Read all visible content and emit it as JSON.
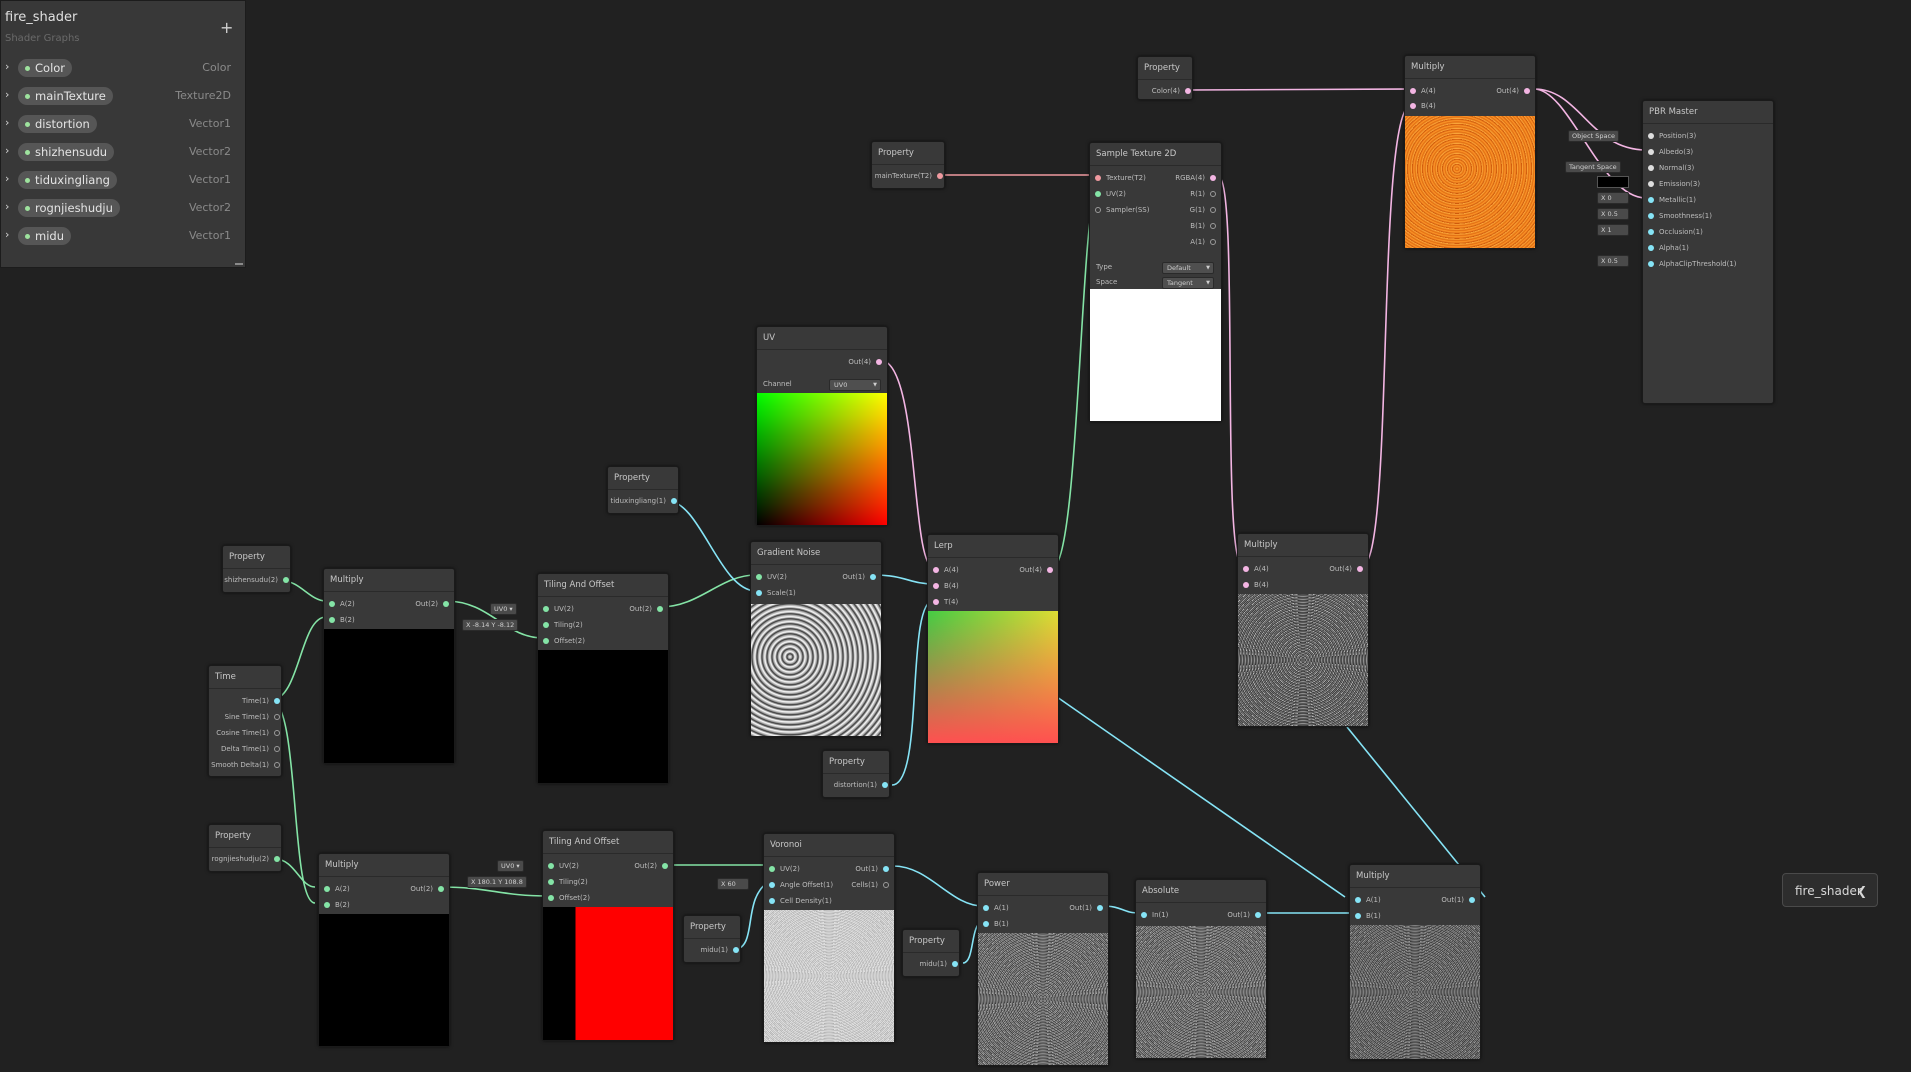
{
  "blackboard": {
    "title": "fire_shader",
    "subtitle": "Shader Graphs",
    "add_label": "+",
    "properties": [
      {
        "name": "Color",
        "type": "Color"
      },
      {
        "name": "mainTexture",
        "type": "Texture2D"
      },
      {
        "name": "distortion",
        "type": "Vector1"
      },
      {
        "name": "shizhensudu",
        "type": "Vector2"
      },
      {
        "name": "tiduxingliang",
        "type": "Vector1"
      },
      {
        "name": "rognjieshudju",
        "type": "Vector2"
      },
      {
        "name": "midu",
        "type": "Vector1"
      }
    ]
  },
  "nodes": {
    "prop_shizhensudu": {
      "title": "Property",
      "out": "shizhensudu(2)"
    },
    "time": {
      "title": "Time",
      "outs": [
        "Time(1)",
        "Sine Time(1)",
        "Cosine Time(1)",
        "Delta Time(1)",
        "Smooth Delta(1)"
      ]
    },
    "prop_rognjieshudju": {
      "title": "Property",
      "out": "rognjieshudju(2)"
    },
    "multiply1": {
      "title": "Multiply",
      "a": "A(2)",
      "b": "B(2)",
      "out": "Out(2)"
    },
    "multiply2": {
      "title": "Multiply",
      "a": "A(2)",
      "b": "B(2)",
      "out": "Out(2)"
    },
    "tiling1": {
      "title": "Tiling And Offset",
      "uv": "UV(2)",
      "tiling": "Tiling(2)",
      "offset": "Offset(2)",
      "out": "Out(2)",
      "uv_box": "UV0 ▾",
      "tiling_box": "X -8.14 Y -8.12"
    },
    "tiling2": {
      "title": "Tiling And Offset",
      "uv": "UV(2)",
      "tiling": "Tiling(2)",
      "offset": "Offset(2)",
      "out": "Out(2)",
      "uv_box": "UV0 ▾",
      "tiling_box": "X 180.1 Y 108.8"
    },
    "prop_tiduxingliang": {
      "title": "Property",
      "out": "tiduxingliang(1)"
    },
    "uv": {
      "title": "UV",
      "out": "Out(4)",
      "channel_label": "Channel",
      "channel_value": "UV0"
    },
    "gradient_noise": {
      "title": "Gradient Noise",
      "uv": "UV(2)",
      "scale": "Scale(1)",
      "out": "Out(1)"
    },
    "prop_distortion": {
      "title": "Property",
      "out": "distortion(1)"
    },
    "lerp": {
      "title": "Lerp",
      "a": "A(4)",
      "b": "B(4)",
      "t": "T(4)",
      "out": "Out(4)"
    },
    "prop_maintexture": {
      "title": "Property",
      "out": "mainTexture(T2)"
    },
    "sample_tex": {
      "title": "Sample Texture 2D",
      "ins": [
        "Texture(T2)",
        "UV(2)",
        "Sampler(SS)"
      ],
      "outs": [
        "RGBA(4)",
        "R(1)",
        "G(1)",
        "B(1)",
        "A(1)"
      ],
      "type_label": "Type",
      "type_value": "Default",
      "space_label": "Space",
      "space_value": "Tangent"
    },
    "prop_color": {
      "title": "Property",
      "out": "Color(4)"
    },
    "multiply_top": {
      "title": "Multiply",
      "a": "A(4)",
      "b": "B(4)",
      "out": "Out(4)"
    },
    "pbr": {
      "title": "PBR Master",
      "ins": [
        "Position(3)",
        "Albedo(3)",
        "Normal(3)",
        "Emission(3)",
        "Metallic(1)",
        "Smoothness(1)",
        "Occlusion(1)",
        "Alpha(1)",
        "AlphaClipThreshold(1)"
      ],
      "boxes": {
        "position": "Object Space",
        "normal": "Tangent Space",
        "metallic": "X 0",
        "smoothness": "X 0.5",
        "occlusion": "X 1",
        "alphaclip": "X 0.5"
      }
    },
    "multiply_mid": {
      "title": "Multiply",
      "a": "A(4)",
      "b": "B(4)",
      "out": "Out(4)"
    },
    "voronoi": {
      "title": "Voronoi",
      "ins": [
        "UV(2)",
        "Angle Offset(1)",
        "Cell Density(1)"
      ],
      "outs": [
        "Out(1)",
        "Cells(1)"
      ],
      "angle_box": "X 60"
    },
    "prop_midu1": {
      "title": "Property",
      "out": "midu(1)"
    },
    "prop_midu2": {
      "title": "Property",
      "out": "midu(1)"
    },
    "power": {
      "title": "Power",
      "a": "A(1)",
      "b": "B(1)",
      "out": "Out(1)"
    },
    "absolute": {
      "title": "Absolute",
      "in": "In(1)",
      "out": "Out(1)"
    },
    "multiply_br": {
      "title": "Multiply",
      "a": "A(1)",
      "b": "B(1)",
      "out": "Out(1)"
    }
  },
  "graph_button": {
    "label": "fire_shader",
    "icon": "chevron-left-icon"
  }
}
